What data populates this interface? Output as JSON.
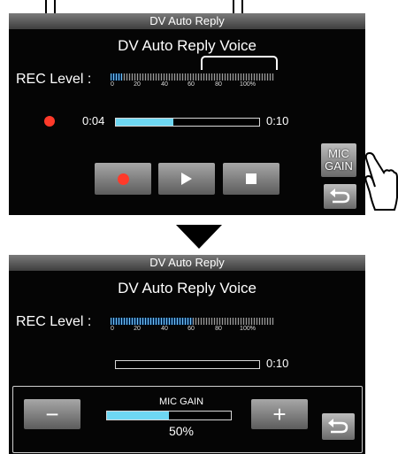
{
  "screen_before": {
    "title": "DV Auto Reply",
    "heading": "DV Auto Reply Voice",
    "rec_level_label": "REC Level :",
    "rec_level_fraction": 0.07,
    "meter_ticks": [
      "0",
      "20",
      "40",
      "60",
      "80",
      "100%"
    ],
    "time_elapsed": "0:04",
    "time_total": "0:10",
    "playback_progress": 0.4,
    "controls": [
      "record",
      "play",
      "stop"
    ],
    "mic_gain_button": [
      "MIC",
      "GAIN"
    ],
    "back_icon": "return-arrow"
  },
  "screen_after": {
    "title": "DV Auto Reply",
    "heading": "DV Auto Reply Voice",
    "rec_level_label": "REC Level :",
    "rec_level_fraction": 0.5,
    "meter_ticks": [
      "0",
      "20",
      "40",
      "60",
      "80",
      "100%"
    ],
    "time_total": "0:10",
    "mic_gain": {
      "label": "MIC GAIN",
      "value_text": "50%",
      "value_fraction": 0.5,
      "minus_symbol": "−",
      "plus_symbol": "+"
    },
    "back_icon": "return-arrow"
  },
  "colors": {
    "record_red": "#ff3a2a",
    "progress_cyan": "#6ed7f2",
    "meter_blue": "#6fc4ff"
  }
}
